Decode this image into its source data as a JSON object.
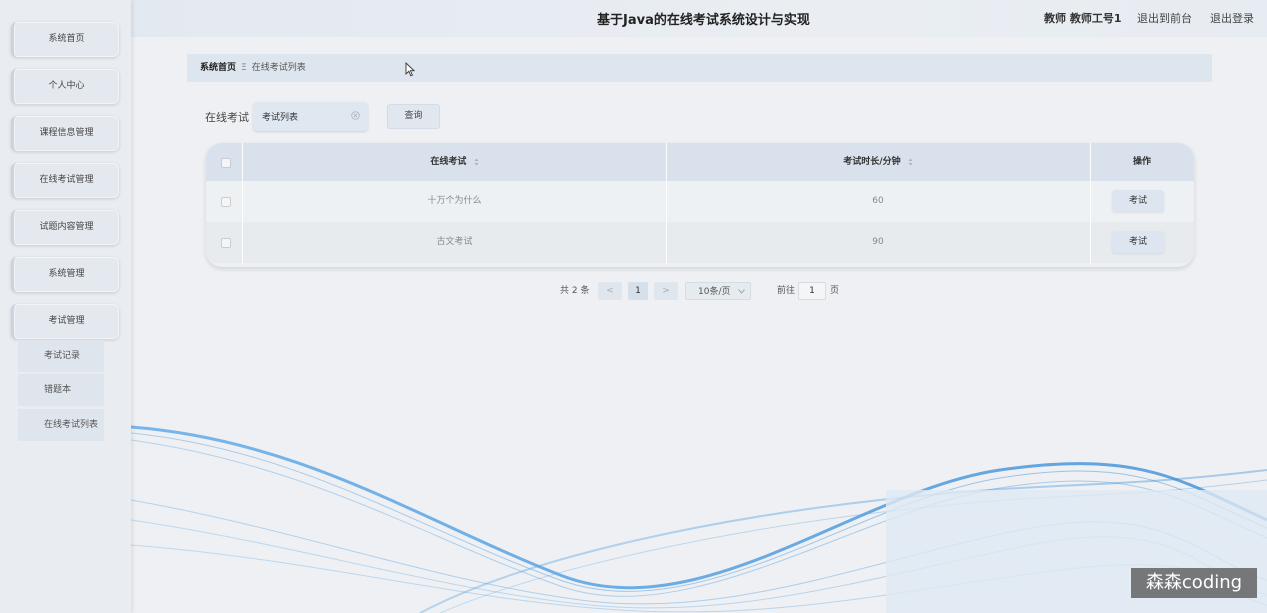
{
  "header": {
    "title": "基于Java的在线考试系统设计与实现",
    "user": "教师 教师工号1",
    "back_to_front": "退出到前台",
    "logout": "退出登录"
  },
  "sidebar": {
    "items": [
      {
        "label": "系统首页"
      },
      {
        "label": "个人中心"
      },
      {
        "label": "课程信息管理"
      },
      {
        "label": "在线考试管理"
      },
      {
        "label": "试题内容管理"
      },
      {
        "label": "系统管理"
      },
      {
        "label": "考试管理"
      }
    ],
    "subitems": [
      {
        "label": "考试记录"
      },
      {
        "label": "错题本"
      },
      {
        "label": "在线考试列表"
      }
    ]
  },
  "breadcrumb": {
    "home": "系统首页",
    "separator": "Ξ",
    "current": "在线考试列表"
  },
  "search": {
    "label": "在线考试",
    "value": "考试列表",
    "button": "查询"
  },
  "table": {
    "columns": [
      "在线考试",
      "考试时长/分钟",
      "操作"
    ],
    "rows": [
      {
        "name": "十万个为什么",
        "duration": "60",
        "action": "考试"
      },
      {
        "name": "古文考试",
        "duration": "90",
        "action": "考试"
      }
    ]
  },
  "pagination": {
    "total": "共 2 条",
    "prev": "<",
    "page": "1",
    "next": ">",
    "page_size": "10条/页",
    "goto_prefix": "前往",
    "goto_value": "1",
    "goto_suffix": "页"
  },
  "watermark": "森森coding",
  "colors": {
    "accent": "#dde5ee",
    "wave": "#4a9be0"
  }
}
